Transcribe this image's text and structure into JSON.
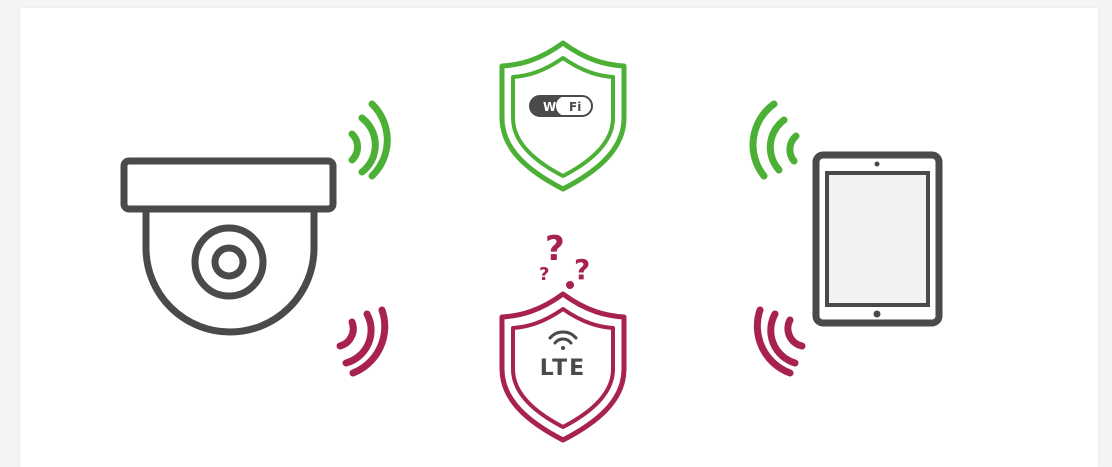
{
  "colors": {
    "device": "#4a4a4a",
    "wifi": "#4db036",
    "lte": "#a8224f",
    "screen": "#f2f2f4",
    "background": "#ffffff"
  },
  "wifi_shield": {
    "label_left": "Wi",
    "label_right": "Fi",
    "icon": "wifi-logo-icon"
  },
  "lte_shield": {
    "label": "LTE",
    "icon": "signal-icon",
    "question_icon": "question-marks-icon"
  },
  "devices": {
    "camera": "dome-camera-icon",
    "tablet": "tablet-icon"
  }
}
